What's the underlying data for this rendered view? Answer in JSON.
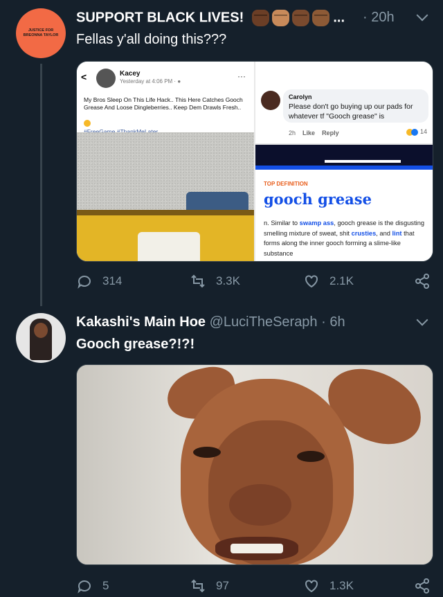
{
  "tweets": [
    {
      "avatar_text": "JUSTICE FOR BREONNA TAYLOR",
      "display_name": "SUPPORT BLACK LIVES!",
      "name_suffix": "...",
      "time": "· 20h",
      "text": "Fellas y'all doing this???",
      "media": {
        "facebook_post": {
          "name": "Kacey",
          "meta": "Yesterday at 4:06 PM · ",
          "post_text": "My Bros Sleep On This Life Hack.. This Here Catches Gooch Grease And Loose Dingleberries.. Keep Dem Drawls Fresh..",
          "hashtags": "#FreeGame #ThankMeLater"
        },
        "comment": {
          "name": "Carolyn",
          "text": "Please don't go buying up our pads for whatever tf \"Gooch grease\" is",
          "time": "2h",
          "like": "Like",
          "reply": "Reply",
          "reaction_count": "14"
        },
        "definition": {
          "label": "TOP DEFINITION",
          "word": "gooch grease",
          "def_prefix": "n. Similar to ",
          "link1": "swamp ass",
          "def_mid1": ", gooch grease is the disgusting smelling mixture of sweat, shit ",
          "link2": "crusties",
          "def_mid2": ", and ",
          "link3": "lint",
          "def_end": " that forms along the inner gooch forming a slime-like substance"
        }
      },
      "actions": {
        "replies": "314",
        "retweets": "3.3K",
        "likes": "2.1K"
      }
    },
    {
      "display_name": "Kakashi's Main Hoe",
      "handle": "@LuciTheSeraph",
      "time": "· 6h",
      "text": "Gooch grease?!?!",
      "actions": {
        "replies": "5",
        "retweets": "97",
        "likes": "1.3K"
      }
    }
  ],
  "colors": {
    "background": "#15202b",
    "muted": "#8899a6",
    "divider": "#38444d",
    "ud_blue": "#134fe6",
    "ud_orange": "#e85d1b"
  },
  "emojis": [
    "raised-fist-dark",
    "raised-fist-medium",
    "raised-fist-dark",
    "raised-fist-medium-dark"
  ]
}
